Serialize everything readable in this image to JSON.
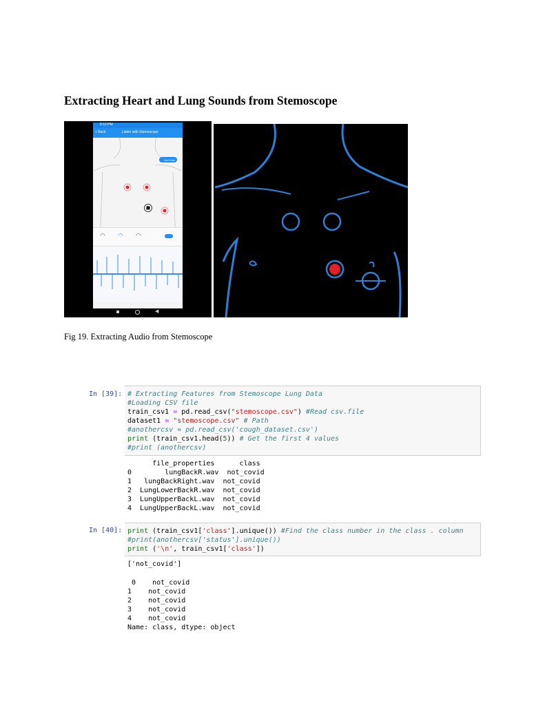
{
  "heading": "Extracting Heart and Lung Sounds from Stemoscope",
  "caption": "Fig 19.  Extracting Audio from Stemoscope",
  "phone": {
    "status_time": "8:10 PM",
    "back_label": "< Back",
    "title": "Listen with Stemoscope",
    "button_label": "Can't hear"
  },
  "cells": [
    {
      "prompt": "In [39]:",
      "code": [
        "# Extracting Features from Stemoscope Lung Data",
        "#Loading CSV file",
        "train_csv1 = pd.read_csv(\"stemoscope.csv\") #Read csv.file",
        "dataset1 = \"stemoscope.csv\" # Path",
        "#anothercsv = pd.read_csv('cough_dataset.csv')",
        "print (train_csv1.head(5)) # Get the first 4 values",
        "#print (anothercsv)"
      ],
      "output": [
        "      file_properties      class",
        "0        lungBackR.wav  not_covid",
        "1   lungBackRight.wav  not_covid",
        "2  LungLowerBackR.wav  not_covid",
        "3  LungUpperBackL.wav  not_covid",
        "4  LungUpperBackL.wav  not_covid"
      ]
    },
    {
      "prompt": "In [40]:",
      "code": [
        "print (train_csv1['class'].unique()) #Find the class number in the class . column",
        "#print(anothercsv['status'].unique())",
        "print ('\\n', train_csv1['class'])"
      ],
      "output": [
        "['not_covid']",
        "",
        " 0    not_covid",
        "1    not_covid",
        "2    not_covid",
        "3    not_covid",
        "4    not_covid",
        "Name: class, dtype: object"
      ]
    }
  ],
  "colors": {
    "outline": "#2f7fd6",
    "marker": "#e0202a",
    "prompt": "#303f9f"
  }
}
